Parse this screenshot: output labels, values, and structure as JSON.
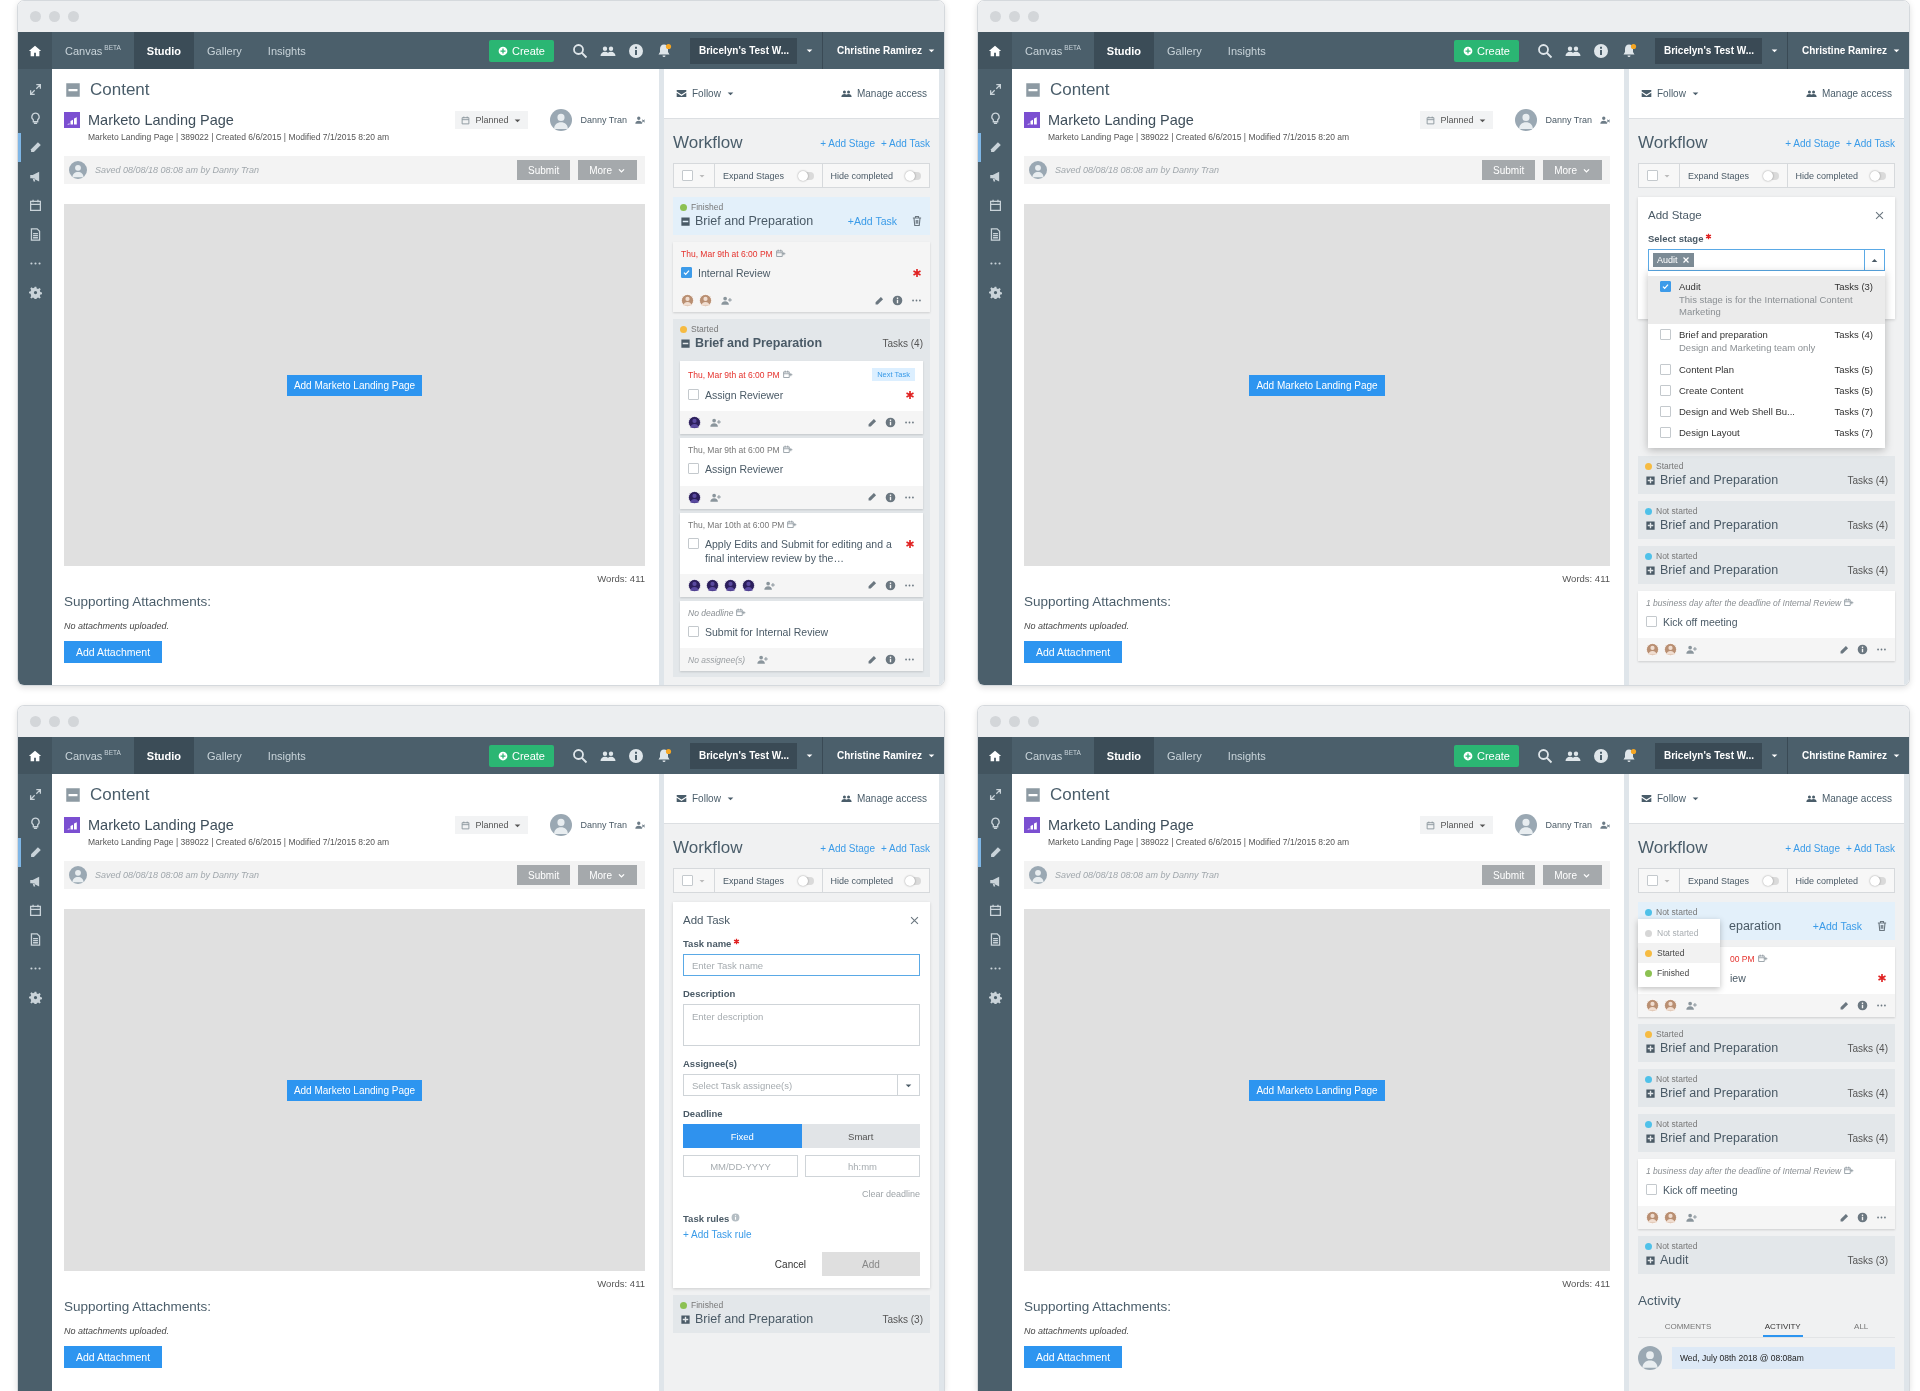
{
  "windows": [
    {
      "nav": {
        "items": [
          {
            "label": "Canvas",
            "tag": "BETA",
            "selected": false
          },
          {
            "label": "Studio",
            "selected": true
          },
          {
            "label": "Gallery",
            "selected": false
          },
          {
            "label": "Insights",
            "selected": false
          }
        ],
        "create": "Create",
        "workspace": "Bricelyn's Test W...",
        "user": "Christine Ramirez"
      },
      "rail": [
        {
          "kind": "expand",
          "selected": false
        },
        {
          "kind": "bulb",
          "selected": false
        },
        {
          "kind": "pencil",
          "selected": true
        },
        {
          "kind": "megaphone",
          "selected": false
        },
        {
          "kind": "calendar",
          "selected": false
        },
        {
          "kind": "document",
          "selected": false
        },
        {
          "kind": "more",
          "selected": false
        },
        {
          "kind": "gear",
          "selected": false
        }
      ],
      "content": {
        "section": "Content",
        "title": "Marketo Landing Page",
        "meta": "Marketo Landing Page |  389022  |  Created 6/6/2015  |  Modified 7/1/2015 8:20 am",
        "status": "Planned",
        "owner": "Danny Tran",
        "saved": "Saved 08/08/18 08:08 am by Danny Tran",
        "submit": "Submit",
        "more": "More",
        "add_button": "Add Marketo Landing Page",
        "words": "Words: 411",
        "attachments_heading": "Supporting Attachments:",
        "attachments_empty": "No attachments uploaded.",
        "add_attachment": "Add Attachment"
      },
      "panel": {
        "follow": "Follow",
        "manage": "Manage access",
        "workflow": "Workflow",
        "add_stage": "+ Add Stage",
        "add_task": "+ Add Task",
        "expand": "Expand Stages",
        "expand_on": false,
        "hide": "Hide completed",
        "hide_on": false,
        "select_all": false,
        "items": [
          {
            "kind": "stage",
            "status": "Finished",
            "color": "#8cc152",
            "title": "Brief and Preparation",
            "expanded": true,
            "highlighted": true,
            "add_task": "+Add Task",
            "tasks": [
              {
                "deadline_fixed": true,
                "date": "Thu, Mar 9th at 6:00 PM",
                "overdue": true,
                "done": true,
                "name": "Internal Review",
                "required": true,
                "assignees": [
                  {
                    "kind": "photo"
                  },
                  {
                    "kind": "photo"
                  }
                ]
              }
            ]
          },
          {
            "kind": "stage",
            "status": "Started",
            "color": "#f6bb42",
            "title": "Brief and Preparation",
            "expanded": true,
            "highlighted": false,
            "count": "Tasks (4)",
            "tasks": [
              {
                "deadline_fixed": true,
                "date": "Thu, Mar 9th at 6:00 PM",
                "overdue": true,
                "badge": "Next Task",
                "done": false,
                "name": "Assign Reviewer",
                "required": true,
                "assignees": [
                  {
                    "kind": "dark"
                  }
                ]
              },
              {
                "deadline_fixed": true,
                "date": "Thu, Mar 9th at 6:00 PM",
                "overdue": false,
                "done": false,
                "name": "Assign Reviewer",
                "required": false,
                "assignees": [
                  {
                    "kind": "dark"
                  }
                ]
              },
              {
                "deadline_fixed": true,
                "date": "Thu, Mar 10th at 6:00 PM",
                "overdue": false,
                "done": false,
                "name": "Apply Edits and Submit for editing and a final interview review by the…",
                "required": true,
                "assignees": [
                  {
                    "kind": "dark"
                  },
                  {
                    "kind": "dark"
                  },
                  {
                    "kind": "dark"
                  },
                  {
                    "kind": "dark"
                  }
                ]
              },
              {
                "deadline_fixed": false,
                "date": "No deadline",
                "overdue": false,
                "done": false,
                "name": "Submit for Internal Review",
                "required": false,
                "no_assignee": "No assignee(s)"
              }
            ]
          }
        ]
      }
    },
    {
      "nav": {
        "items": [
          {
            "label": "Canvas",
            "tag": "BETA",
            "selected": false
          },
          {
            "label": "Studio",
            "selected": true
          },
          {
            "label": "Gallery",
            "selected": false
          },
          {
            "label": "Insights",
            "selected": false
          }
        ],
        "create": "Create",
        "workspace": "Bricelyn's Test W...",
        "user": "Christine Ramirez"
      },
      "rail": [
        {
          "kind": "expand",
          "selected": false
        },
        {
          "kind": "bulb",
          "selected": false
        },
        {
          "kind": "pencil",
          "selected": true
        },
        {
          "kind": "megaphone",
          "selected": false
        },
        {
          "kind": "calendar",
          "selected": false
        },
        {
          "kind": "document",
          "selected": false
        },
        {
          "kind": "more",
          "selected": false
        },
        {
          "kind": "gear",
          "selected": false
        }
      ],
      "content": {
        "section": "Content",
        "title": "Marketo Landing Page",
        "meta": "Marketo Landing Page |  389022  |  Created 6/6/2015  |  Modified 7/1/2015 8:20 am",
        "status": "Planned",
        "owner": "Danny Tran",
        "saved": "Saved 08/08/18 08:08 am by Danny Tran",
        "submit": "Submit",
        "more": "More",
        "add_button": "Add Marketo Landing Page",
        "words": "Words: 411",
        "attachments_heading": "Supporting Attachments:",
        "attachments_empty": "No attachments uploaded.",
        "add_attachment": "Add Attachment"
      },
      "panel": {
        "follow": "Follow",
        "manage": "Manage access",
        "workflow": "Workflow",
        "add_stage": "+ Add Stage",
        "add_task": "+ Add Task",
        "expand": "Expand Stages",
        "expand_on": false,
        "hide": "Hide completed",
        "hide_on": false,
        "select_all": false,
        "items": [
          {
            "kind": "add_stage",
            "title": "Add Stage",
            "label": "Select stage",
            "tag": "Audit",
            "options": [
              {
                "name": "Audit",
                "tasks": "Tasks (3)",
                "description": "This stage is for the International Content Marketing",
                "checked": true,
                "hovered": true
              },
              {
                "name": "Brief and preparation",
                "tasks": "Tasks (4)",
                "description": "Design and Marketing team only",
                "checked": false,
                "hovered": false
              },
              {
                "name": "Content Plan",
                "tasks": "Tasks (5)",
                "checked": false,
                "hovered": false
              },
              {
                "name": "Create Content",
                "tasks": "Tasks (5)",
                "checked": false,
                "hovered": false
              },
              {
                "name": "Design and Web Shell Bu...",
                "tasks": "Tasks (7)",
                "checked": false,
                "hovered": false
              },
              {
                "name": "Design Layout",
                "tasks": "Tasks (7)",
                "checked": false,
                "hovered": false
              }
            ]
          },
          {
            "kind": "stage",
            "status": "Started",
            "color": "#f6bb42",
            "title": "Brief and Preparation",
            "expanded": false,
            "highlighted": false,
            "count": "Tasks (4)"
          },
          {
            "kind": "stage",
            "status": "Not started",
            "color": "#4fc1e9",
            "title": "Brief and Preparation",
            "expanded": false,
            "highlighted": false,
            "count": "Tasks (4)"
          },
          {
            "kind": "stage",
            "status": "Not started",
            "color": "#4fc1e9",
            "title": "Brief and Preparation",
            "expanded": false,
            "highlighted": false,
            "count": "Tasks (4)"
          },
          {
            "kind": "task",
            "deadline_fixed": false,
            "date": "1 business day after the deadline of Internal Review",
            "overdue": false,
            "done": false,
            "name": "Kick off meeting",
            "required": false,
            "assignees": [
              {
                "kind": "photo"
              },
              {
                "kind": "photo"
              }
            ]
          }
        ]
      }
    },
    {
      "nav": {
        "items": [
          {
            "label": "Canvas",
            "tag": "BETA",
            "selected": false
          },
          {
            "label": "Studio",
            "selected": true
          },
          {
            "label": "Gallery",
            "selected": false
          },
          {
            "label": "Insights",
            "selected": false
          }
        ],
        "create": "Create",
        "workspace": "Bricelyn's Test W...",
        "user": "Christine Ramirez"
      },
      "rail": [
        {
          "kind": "expand",
          "selected": false
        },
        {
          "kind": "bulb",
          "selected": false
        },
        {
          "kind": "pencil",
          "selected": true
        },
        {
          "kind": "megaphone",
          "selected": false
        },
        {
          "kind": "calendar",
          "selected": false
        },
        {
          "kind": "document",
          "selected": false
        },
        {
          "kind": "more",
          "selected": false
        },
        {
          "kind": "gear",
          "selected": false
        }
      ],
      "content": {
        "section": "Content",
        "title": "Marketo Landing Page",
        "meta": "Marketo Landing Page |  389022  |  Created 6/6/2015  |  Modified 7/1/2015 8:20 am",
        "status": "Planned",
        "owner": "Danny Tran",
        "saved": "Saved 08/08/18 08:08 am by Danny Tran",
        "submit": "Submit",
        "more": "More",
        "add_button": "Add Marketo Landing Page",
        "words": "Words: 411",
        "attachments_heading": "Supporting Attachments:",
        "attachments_empty": "No attachments uploaded.",
        "add_attachment": "Add Attachment"
      },
      "panel": {
        "follow": "Follow",
        "manage": "Manage access",
        "workflow": "Workflow",
        "add_stage": "+ Add Stage",
        "add_task": "+ Add Task",
        "expand": "Expand Stages",
        "expand_on": false,
        "hide": "Hide completed",
        "hide_on": false,
        "select_all": false,
        "items": [
          {
            "kind": "add_task",
            "title": "Add Task",
            "name_label": "Task name",
            "name_placeholder": "Enter Task name",
            "desc_label": "Description",
            "desc_placeholder": "Enter description",
            "assignee_label": "Assignee(s)",
            "assignee_placeholder": "Select Task assignee(s)",
            "deadline_label": "Deadline",
            "modes": [
              {
                "label": "Fixed",
                "selected": true
              },
              {
                "label": "Smart",
                "selected": false
              }
            ],
            "date_placeholder": "MM/DD-YYYY",
            "time_placeholder": "hh:mm",
            "clear": "Clear deadline",
            "rules_label": "Task rules",
            "add_rule": "+ Add Task rule",
            "cancel": "Cancel",
            "submit": "Add"
          },
          {
            "kind": "stage",
            "status": "Finished",
            "color": "#8cc152",
            "title": "Brief and Preparation",
            "expanded": false,
            "highlighted": false,
            "count": "Tasks (3)"
          }
        ]
      }
    },
    {
      "nav": {
        "items": [
          {
            "label": "Canvas",
            "tag": "BETA",
            "selected": false
          },
          {
            "label": "Studio",
            "selected": true
          },
          {
            "label": "Gallery",
            "selected": false
          },
          {
            "label": "Insights",
            "selected": false
          }
        ],
        "create": "Create",
        "workspace": "Bricelyn's Test W...",
        "user": "Christine Ramirez"
      },
      "rail": [
        {
          "kind": "expand",
          "selected": false
        },
        {
          "kind": "bulb",
          "selected": false
        },
        {
          "kind": "pencil",
          "selected": true
        },
        {
          "kind": "megaphone",
          "selected": false
        },
        {
          "kind": "calendar",
          "selected": false
        },
        {
          "kind": "document",
          "selected": false
        },
        {
          "kind": "more",
          "selected": false
        },
        {
          "kind": "gear",
          "selected": false
        }
      ],
      "content": {
        "section": "Content",
        "title": "Marketo Landing Page",
        "meta": "Marketo Landing Page |  389022  |  Created 6/6/2015  |  Modified 7/1/2015 8:20 am",
        "status": "Planned",
        "owner": "Danny Tran",
        "saved": "Saved 08/08/18 08:08 am by Danny Tran",
        "submit": "Submit",
        "more": "More",
        "add_button": "Add Marketo Landing Page",
        "words": "Words: 411",
        "attachments_heading": "Supporting Attachments:",
        "attachments_empty": "No attachments uploaded.",
        "add_attachment": "Add Attachment"
      },
      "panel": {
        "follow": "Follow",
        "manage": "Manage access",
        "workflow": "Workflow",
        "add_stage": "+ Add Stage",
        "add_task": "+ Add Task",
        "expand": "Expand Stages",
        "expand_on": false,
        "hide": "Hide completed",
        "hide_on": false,
        "select_all": false,
        "items": [
          {
            "kind": "stage",
            "status": "Not started",
            "color": "#4fc1e9",
            "title": "eparation",
            "expanded": true,
            "highlighted": true,
            "add_task": "+Add Task",
            "menu": [
              {
                "label": "Not started",
                "color": "#d6d6d6",
                "disabled": true,
                "hovered": false
              },
              {
                "label": "Started",
                "color": "#f6bb42",
                "disabled": false,
                "hovered": true
              },
              {
                "label": "Finished",
                "color": "#8cc152",
                "disabled": false,
                "hovered": false
              }
            ],
            "tasks": [
              {
                "deadline_fixed": true,
                "date": "00 PM",
                "overdue": true,
                "name": "iew",
                "required": true,
                "assignees": [
                  {
                    "kind": "photo"
                  },
                  {
                    "kind": "photo"
                  }
                ]
              }
            ]
          },
          {
            "kind": "stage",
            "status": "Started",
            "color": "#f6bb42",
            "title": "Brief and Preparation",
            "expanded": false,
            "highlighted": false,
            "count": "Tasks (4)"
          },
          {
            "kind": "stage",
            "status": "Not started",
            "color": "#4fc1e9",
            "title": "Brief and Preparation",
            "expanded": false,
            "highlighted": false,
            "count": "Tasks (4)"
          },
          {
            "kind": "stage",
            "status": "Not started",
            "color": "#4fc1e9",
            "title": "Brief and Preparation",
            "expanded": false,
            "highlighted": false,
            "count": "Tasks (4)"
          },
          {
            "kind": "task",
            "deadline_fixed": false,
            "date": "1 business day after the deadline of Internal Review",
            "overdue": false,
            "done": false,
            "name": "Kick off meeting",
            "required": false,
            "assignees": [
              {
                "kind": "photo"
              },
              {
                "kind": "photo"
              }
            ]
          },
          {
            "kind": "stage",
            "status": "Not started",
            "color": "#4fc1e9",
            "title": "Audit",
            "expanded": false,
            "highlighted": false,
            "count": "Tasks (3)"
          },
          {
            "kind": "activity",
            "title": "Activity",
            "tabs": [
              {
                "label": "COMMENTS",
                "selected": false
              },
              {
                "label": "ACTIVITY",
                "selected": true
              },
              {
                "label": "ALL",
                "selected": false
              }
            ],
            "entries": [
              {
                "date": "Wed, July 08th 2018 @ 08:08am"
              }
            ]
          }
        ]
      }
    }
  ]
}
